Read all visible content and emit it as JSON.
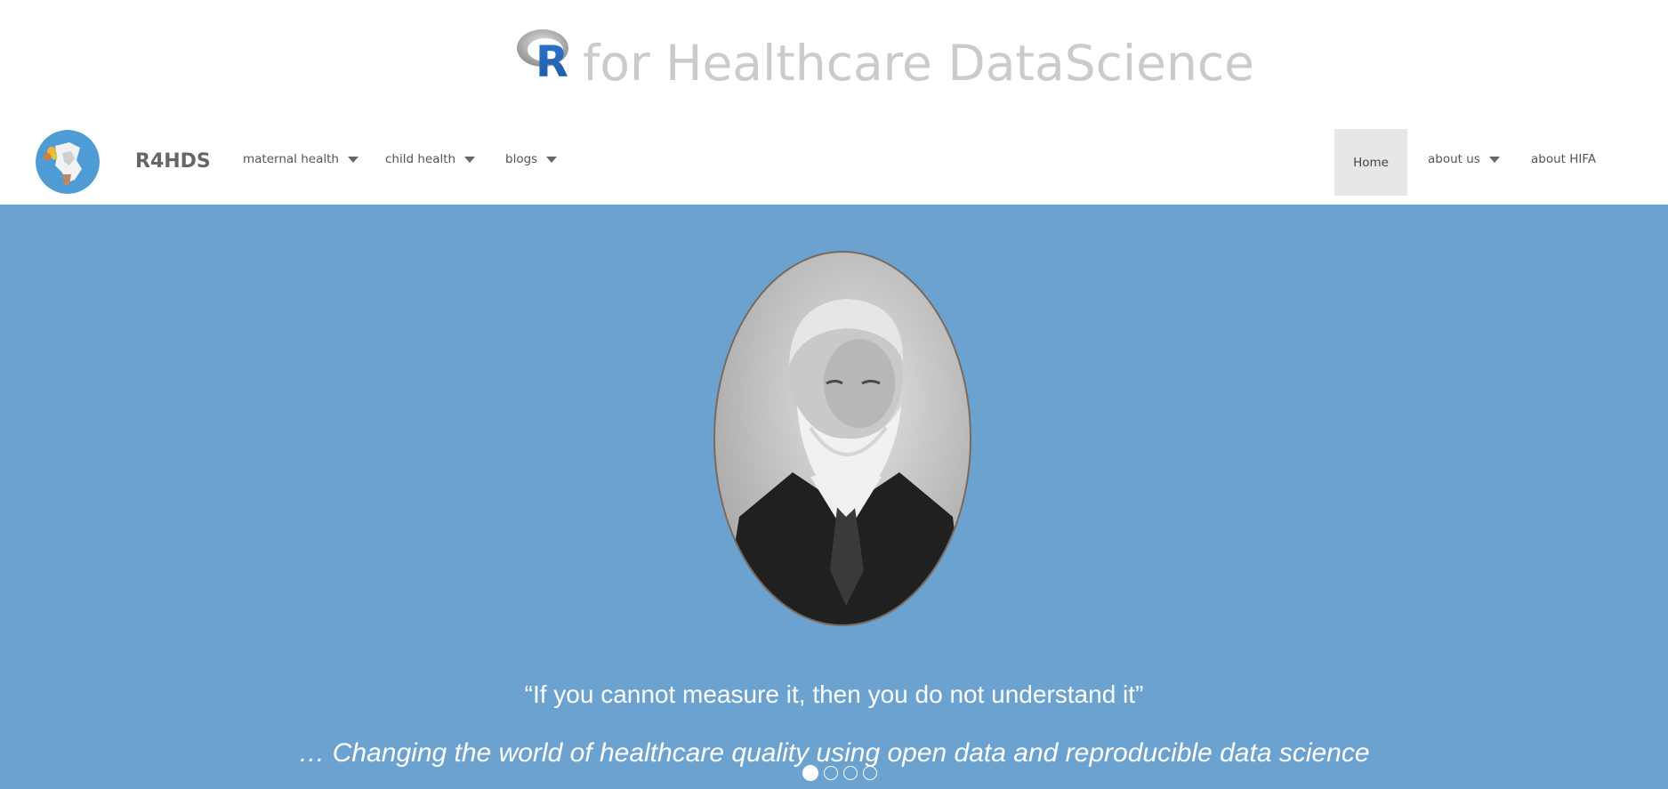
{
  "banner": {
    "logo_letter": "R",
    "title": "for Healthcare DataScience"
  },
  "nav": {
    "brand": "R4HDS",
    "items_left": [
      {
        "label": "maternal health",
        "has_dropdown": true
      },
      {
        "label": "child health",
        "has_dropdown": true
      },
      {
        "label": "blogs",
        "has_dropdown": true
      }
    ],
    "items_right": [
      {
        "label": "Home",
        "active": true
      },
      {
        "label": "about us",
        "has_dropdown": true
      },
      {
        "label": "about HIFA",
        "has_dropdown": false
      }
    ]
  },
  "hero": {
    "quote": "“If you cannot measure it, then you do not understand it”",
    "tagline": "… Changing the world of healthcare quality using open data and reproducible data science",
    "slides_total": 4,
    "active_slide": 1
  },
  "colors": {
    "hero_bg": "#6ba2d0",
    "banner_title": "#cbcbcb",
    "active_nav_bg": "#e7e7e7",
    "r_blue": "#2165b6"
  },
  "icons": {
    "logo": "r-logo-icon",
    "avatar": "globe-avatar-icon",
    "caret": "caret-down-icon",
    "dot": "carousel-dot-icon"
  }
}
